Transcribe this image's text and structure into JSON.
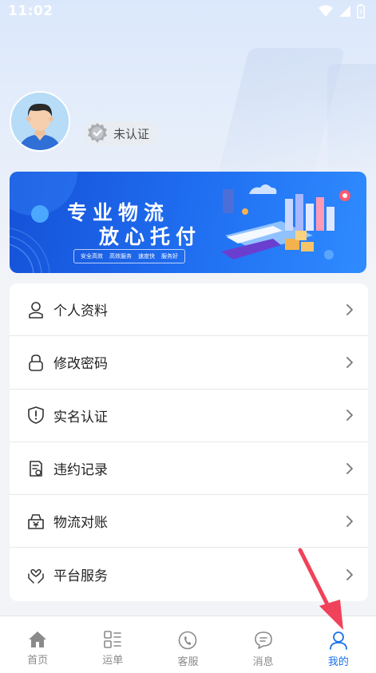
{
  "status_bar": {
    "time": "11:02"
  },
  "profile": {
    "verify_status": "未认证"
  },
  "banner": {
    "title_line1": "专业物流",
    "title_line2": "放心托付",
    "tags": [
      "安全高效",
      "高效服务",
      "速度快",
      "服务好"
    ]
  },
  "menu": {
    "items": [
      {
        "label": "个人资料",
        "icon": "person-icon"
      },
      {
        "label": "修改密码",
        "icon": "lock-icon"
      },
      {
        "label": "实名认证",
        "icon": "shield-icon"
      },
      {
        "label": "违约记录",
        "icon": "document-icon"
      },
      {
        "label": "物流对账",
        "icon": "money-box-icon"
      },
      {
        "label": "平台服务",
        "icon": "hands-heart-icon"
      }
    ]
  },
  "tabs": [
    {
      "label": "首页",
      "icon": "home-icon",
      "active": false
    },
    {
      "label": "运单",
      "icon": "grid-list-icon",
      "active": false
    },
    {
      "label": "客服",
      "icon": "phone-icon",
      "active": false
    },
    {
      "label": "消息",
      "icon": "chat-icon",
      "active": false
    },
    {
      "label": "我的",
      "icon": "user-icon",
      "active": true
    }
  ],
  "colors": {
    "accent": "#1a73e8",
    "annotation_arrow": "#f0425a"
  }
}
